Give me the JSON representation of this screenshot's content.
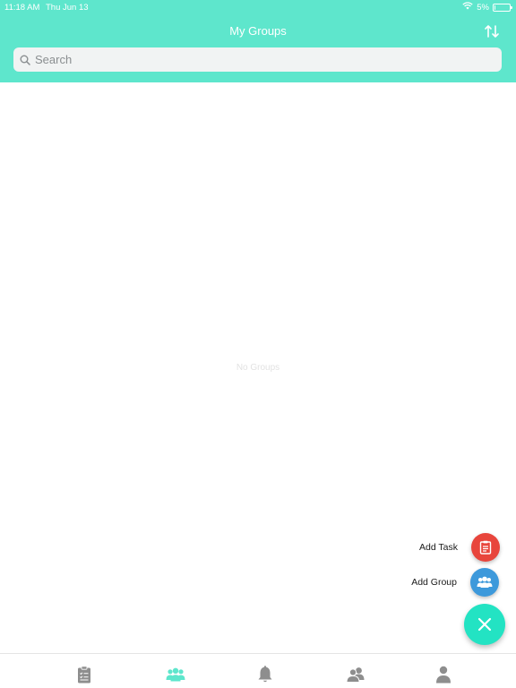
{
  "status_bar": {
    "time": "11:18 AM",
    "date": "Thu Jun 13",
    "battery": "5%",
    "battery_level": 0.05
  },
  "header": {
    "title": "My Groups",
    "sort_icon": "sort-arrows-icon"
  },
  "search": {
    "placeholder": "Search",
    "value": ""
  },
  "empty_state": "No Groups",
  "fab_menu": {
    "items": [
      {
        "label": "Add Task",
        "icon": "clipboard-icon",
        "color": "#e8453c"
      },
      {
        "label": "Add Group",
        "icon": "group-icon",
        "color": "#3d99db"
      }
    ],
    "main_icon": "close-icon",
    "main_color": "#23e3c3"
  },
  "tabs": [
    {
      "name": "tasks",
      "icon": "clipboard-icon",
      "active": false
    },
    {
      "name": "groups",
      "icon": "group-icon",
      "active": true
    },
    {
      "name": "notifications",
      "icon": "bell-icon",
      "active": false
    },
    {
      "name": "contacts",
      "icon": "contacts-icon",
      "active": false
    },
    {
      "name": "profile",
      "icon": "person-icon",
      "active": false
    }
  ],
  "colors": {
    "header": "#5ee6cc",
    "tab_active": "#5ee6cc",
    "tab_inactive": "#8e8e8e"
  }
}
